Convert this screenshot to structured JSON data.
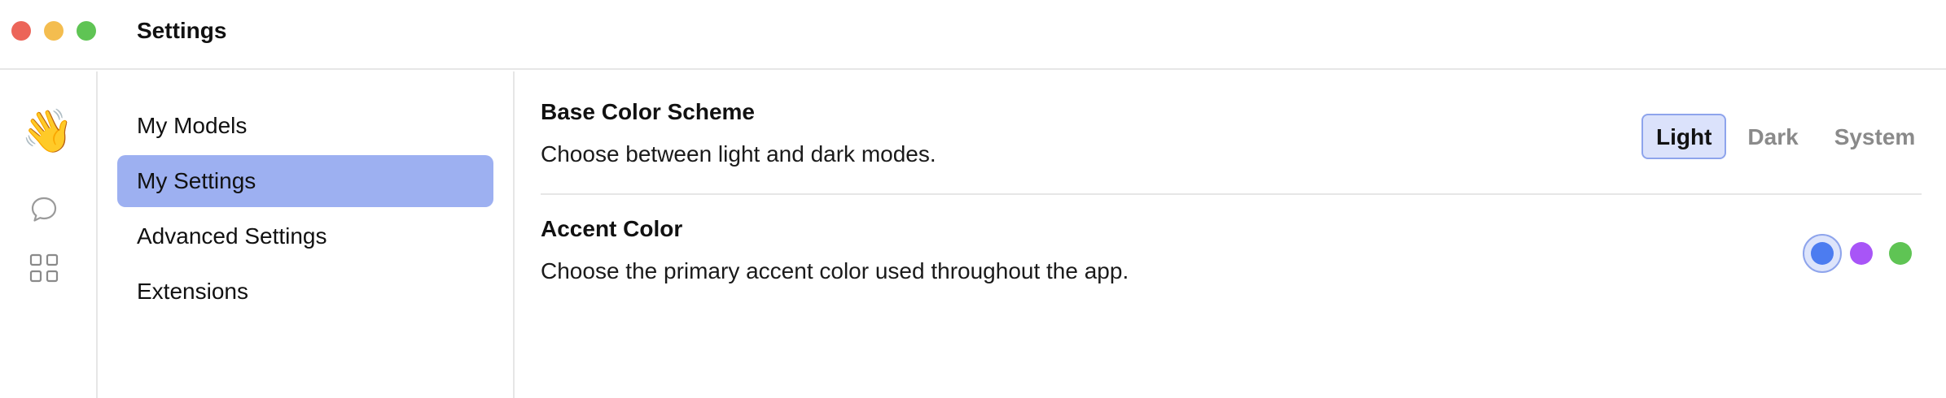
{
  "window": {
    "title": "Settings",
    "controls": [
      "close",
      "minimize",
      "maximize"
    ]
  },
  "rail": {
    "items": [
      {
        "icon": "waving-hand-icon",
        "glyph": "👋"
      },
      {
        "icon": "chat-bubble-icon"
      },
      {
        "icon": "grid-apps-icon"
      }
    ]
  },
  "nav": {
    "items": [
      {
        "label": "My Models",
        "active": false
      },
      {
        "label": "My Settings",
        "active": true
      },
      {
        "label": "Advanced Settings",
        "active": false
      },
      {
        "label": "Extensions",
        "active": false
      }
    ]
  },
  "settings": {
    "color_scheme": {
      "title": "Base Color Scheme",
      "description": "Choose between light and dark modes.",
      "options": [
        "Light",
        "Dark",
        "System"
      ],
      "selected": "Light"
    },
    "accent_color": {
      "title": "Accent Color",
      "description": "Choose the primary accent color used throughout the app.",
      "options": [
        "#4c7cf0",
        "#a855f7",
        "#5fc454"
      ],
      "selected": "#4c7cf0"
    }
  },
  "colors": {
    "active_nav_bg": "#9db0f1",
    "segment_active_bg": "#dbe2fb",
    "segment_active_border": "#8ea4ec"
  }
}
